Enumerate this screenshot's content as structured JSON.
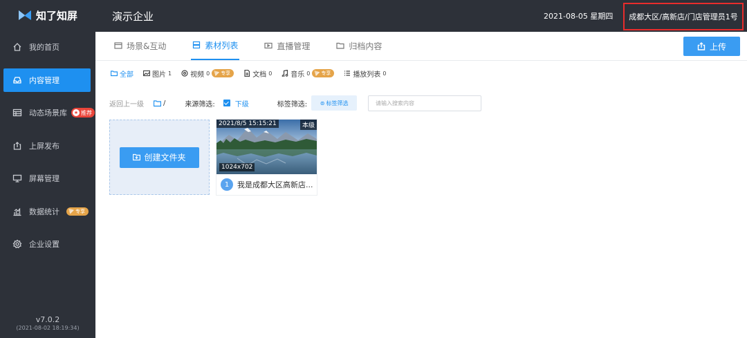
{
  "brand": {
    "name": "知了知屏"
  },
  "sidebar": {
    "items": [
      {
        "label": "我的首页",
        "icon": "home-icon"
      },
      {
        "label": "内容管理",
        "icon": "inbox-icon",
        "active": true
      },
      {
        "label": "动态场景库",
        "icon": "table-icon",
        "badge": "推荐"
      },
      {
        "label": "上屏发布",
        "icon": "share-icon"
      },
      {
        "label": "屏幕管理",
        "icon": "monitor-icon"
      },
      {
        "label": "数据统计",
        "icon": "chart-icon",
        "badge": "专享"
      },
      {
        "label": "企业设置",
        "icon": "gear-icon"
      }
    ],
    "version": "v7.0.2",
    "build_date": "(2021-08-02 18:19:34)"
  },
  "header": {
    "company": "演示企业",
    "date": "2021-08-05 星期四",
    "user": "成都大区/高新店/门店管理员1号"
  },
  "tabs": [
    {
      "label": "场景&互动",
      "icon": "scene-icon"
    },
    {
      "label": "素材列表",
      "icon": "list-icon",
      "active": true
    },
    {
      "label": "直播管理",
      "icon": "live-icon"
    },
    {
      "label": "归档内容",
      "icon": "folder-icon"
    }
  ],
  "upload_label": "上传",
  "types": [
    {
      "label": "全部",
      "count": "",
      "icon": "folder-icon",
      "active": true
    },
    {
      "label": "图片",
      "count": "1",
      "icon": "image-icon"
    },
    {
      "label": "视频",
      "count": "0",
      "icon": "video-icon",
      "badge": "专享"
    },
    {
      "label": "文档",
      "count": "0",
      "icon": "doc-icon"
    },
    {
      "label": "音乐",
      "count": "0",
      "icon": "music-icon",
      "badge": "专享"
    },
    {
      "label": "播放列表",
      "count": "0",
      "icon": "playlist-icon"
    }
  ],
  "filters": {
    "back": "返回上一级",
    "path": "/",
    "source_label": "来源筛选:",
    "source_option": "下级",
    "tag_label": "标签筛选:",
    "tag_button": "标签筛选",
    "search_placeholder": "请输入搜索内容"
  },
  "create_folder_label": "创建文件夹",
  "materials": [
    {
      "timestamp": "2021/8/5 15:15:21",
      "level": "本级",
      "resolution": "1024x702",
      "index": "1",
      "title": "我是成都大区高新店..."
    }
  ],
  "colors": {
    "accent": "#1e90f0",
    "sidebar_bg": "#2d3139",
    "pro_badge": "#e5a449",
    "rec_badge": "#e9453a"
  }
}
